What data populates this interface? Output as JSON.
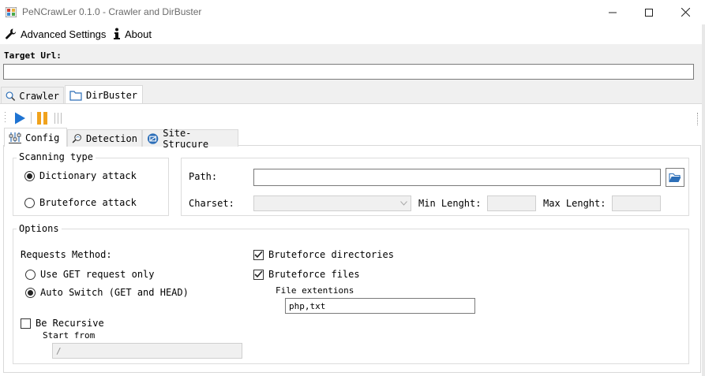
{
  "window": {
    "title": "PeNCrawLer 0.1.0 - Crawler and DirBuster",
    "minimize_glyph": "—",
    "maximize_glyph": "☐",
    "close_glyph": "✕"
  },
  "menu": {
    "advanced_settings": "Advanced Settings",
    "about": "About"
  },
  "target": {
    "label": "Target Url:",
    "value": ""
  },
  "tabs": [
    {
      "label": "Crawler",
      "icon": "search-icon",
      "active": false
    },
    {
      "label": "DirBuster",
      "icon": "folder-icon",
      "active": true
    }
  ],
  "toolbar": {
    "play_icon": "play-icon",
    "pause_icon": "pause-icon",
    "accent": "#1e73d2",
    "pause_color": "#f0a21c"
  },
  "inner_tabs": [
    {
      "label": "Config",
      "icon": "sliders-icon",
      "active": true
    },
    {
      "label": "Detection",
      "icon": "magnifier-icon",
      "active": false
    },
    {
      "label": "Site-Strucure",
      "icon": "sitemap-icon",
      "active": false
    }
  ],
  "scanning": {
    "title": "Scanning type",
    "dictionary": "Dictionary attack",
    "bruteforce": "Bruteforce attack",
    "selected": "dictionary"
  },
  "path_panel": {
    "path_label": "Path:",
    "path_value": "",
    "charset_label": "Charset:",
    "charset_value": "",
    "min_label": "Min Lenght:",
    "min_value": "",
    "max_label": "Max Lenght:",
    "max_value": ""
  },
  "options": {
    "title": "Options",
    "requests_method_label": "Requests Method:",
    "get_only": "Use GET request only",
    "auto_switch": "Auto Switch (GET and HEAD)",
    "selected_method": "auto",
    "be_recursive": "Be Recursive",
    "be_recursive_checked": false,
    "start_from_label": "Start from",
    "start_from_value": "/",
    "brute_dirs": "Bruteforce directories",
    "brute_dirs_checked": true,
    "brute_files": "Bruteforce files",
    "brute_files_checked": true,
    "file_ext_label": "File extentions",
    "file_ext_value": "php,txt"
  }
}
